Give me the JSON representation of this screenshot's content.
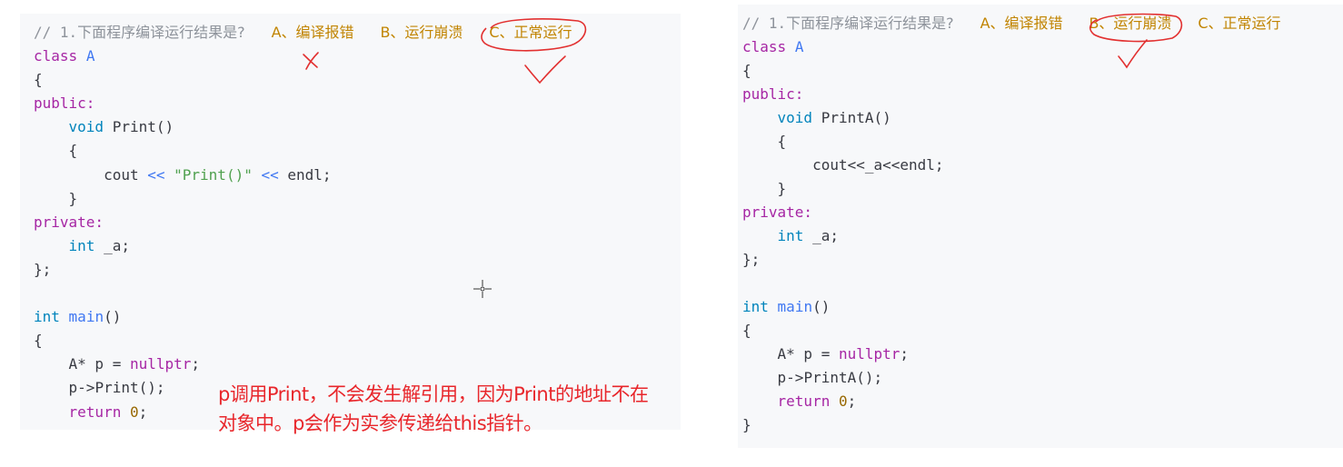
{
  "left_panel": {
    "question_prefix": "// 1.",
    "question_text": "下面程序编译运行结果是?",
    "options": [
      "A、编译报错",
      "B、运行崩溃",
      "C、正常运行"
    ],
    "code": {
      "class_kw": "class",
      "class_name": "A",
      "open_brace": "{",
      "public_kw": "public:",
      "void_kw": "void",
      "method_name": "Print",
      "method_parens": "()",
      "method_open": "{",
      "cout": "cout",
      "op1": "<<",
      "string_literal": "\"Print()\"",
      "op2": "<<",
      "endl": "endl;",
      "method_close": "}",
      "private_kw": "private:",
      "int_kw": "int",
      "member": "_a;",
      "class_close": "};",
      "main_int": "int",
      "main_name": "main",
      "main_parens": "()",
      "main_open": "{",
      "ptr_decl": "A* p = ",
      "nullptr_kw": "nullptr",
      "ptr_semicolon": ";",
      "call_obj": "p->",
      "call_fn": "Print",
      "call_tail": "();",
      "return_kw": "return",
      "return_val": "0",
      "return_semicolon": ";"
    },
    "annotation_line1": "p调用Print，不会发生解引用，因为Print的地址不在",
    "annotation_line2": "对象中。p会作为实参传递给this指针。",
    "marks": {
      "wrong_option": "A",
      "correct_option": "C"
    }
  },
  "right_panel": {
    "question_prefix": "// 1.",
    "question_text": "下面程序编译运行结果是?",
    "options": [
      "A、编译报错",
      "B、运行崩溃",
      "C、正常运行"
    ],
    "code": {
      "class_kw": "class",
      "class_name": "A",
      "open_brace": "{",
      "public_kw": "public:",
      "void_kw": "void",
      "method_name": "PrintA",
      "method_parens": "()",
      "method_open": "{",
      "body": "cout<<_a<<endl;",
      "method_close": "}",
      "private_kw": "private:",
      "int_kw": "int",
      "member": "_a;",
      "class_close": "};",
      "main_int": "int",
      "main_name": "main",
      "main_parens": "()",
      "main_open": "{",
      "ptr_decl": "A* p = ",
      "nullptr_kw": "nullptr",
      "ptr_semicolon": ";",
      "call_obj": "p->",
      "call_fn": "PrintA",
      "call_tail": "();",
      "return_kw": "return",
      "return_val": "0",
      "return_semicolon": ";",
      "main_close": "}"
    },
    "marks": {
      "correct_option": "B"
    }
  },
  "colors": {
    "panel_bg": "#f7f8fa",
    "comment": "#8e939b",
    "keyword": "#a626a4",
    "type": "#0184bc",
    "function": "#4078f2",
    "string": "#50a14f",
    "number": "#986801",
    "option": "#c18401",
    "annotation_red": "#e8262b"
  },
  "icons": [
    "crosshair-cursor-icon"
  ]
}
